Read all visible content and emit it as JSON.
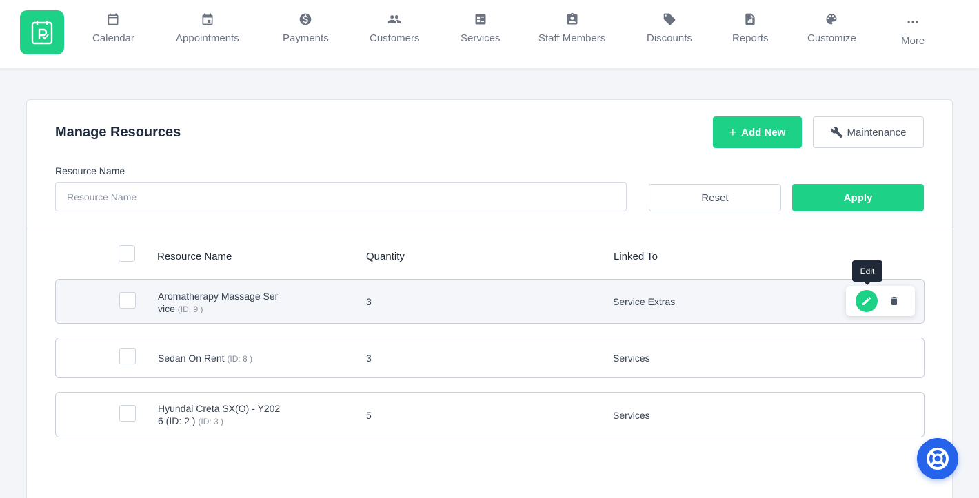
{
  "nav": {
    "items": [
      {
        "label": "Calendar",
        "icon": "calendar-icon"
      },
      {
        "label": "Appointments",
        "icon": "appointment-icon"
      },
      {
        "label": "Payments",
        "icon": "dollar-icon"
      },
      {
        "label": "Customers",
        "icon": "users-icon"
      },
      {
        "label": "Services",
        "icon": "services-icon"
      },
      {
        "label": "Staff Members",
        "icon": "badge-icon"
      },
      {
        "label": "Discounts",
        "icon": "tag-icon"
      },
      {
        "label": "Reports",
        "icon": "report-icon"
      },
      {
        "label": "Customize",
        "icon": "palette-icon"
      },
      {
        "label": "More",
        "icon": "more-icon"
      }
    ]
  },
  "page": {
    "title": "Manage Resources",
    "add_new_label": "Add New",
    "maintenance_label": "Maintenance"
  },
  "filter": {
    "label": "Resource Name",
    "placeholder": "Resource Name",
    "reset_label": "Reset",
    "apply_label": "Apply"
  },
  "table": {
    "headers": {
      "name": "Resource Name",
      "quantity": "Quantity",
      "linked": "Linked To"
    },
    "rows": [
      {
        "name_line1": "Aromatherapy Massage Ser",
        "name_line2": "vice",
        "id_label": "(ID: 9 )",
        "quantity": "3",
        "linked": "Service Extras"
      },
      {
        "name_line1": "Sedan On Rent",
        "name_line2": "",
        "id_label": "(ID: 8 )",
        "quantity": "3",
        "linked": "Services"
      },
      {
        "name_line1": "Hyundai Creta SX(O) - Y202",
        "name_line2": "6 (ID: 2 )",
        "id_label": "(ID: 3 )",
        "quantity": "5",
        "linked": "Services"
      }
    ]
  },
  "tooltip": {
    "edit": "Edit"
  },
  "colors": {
    "accent": "#1dd187",
    "help": "#2563eb",
    "tooltip": "#1f2937"
  }
}
